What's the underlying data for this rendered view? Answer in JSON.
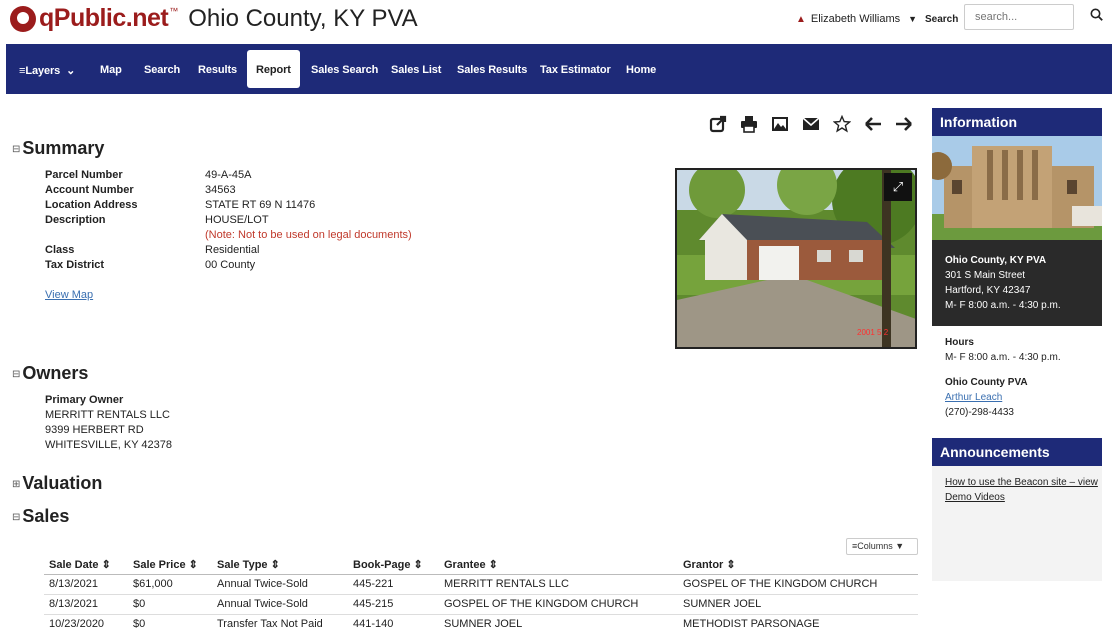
{
  "header": {
    "logo_text": "qPublic.net",
    "logo_tm": "™",
    "county_title": "Ohio County, KY PVA",
    "user_name": "Elizabeth Williams",
    "search_label": "Search",
    "search_placeholder": "search..."
  },
  "nav": {
    "layers": "Layers",
    "map": "Map",
    "search": "Search",
    "results": "Results",
    "report": "Report",
    "sales_search": "Sales Search",
    "sales_list": "Sales List",
    "sales_results": "Sales Results",
    "tax_estimator": "Tax Estimator",
    "home": "Home"
  },
  "summary": {
    "title": "Summary",
    "fields": [
      {
        "label": "Parcel Number",
        "value": "49-A-45A"
      },
      {
        "label": "Account Number",
        "value": "34563"
      },
      {
        "label": "Location Address",
        "value": "STATE RT 69 N 11476"
      },
      {
        "label": "Description",
        "value": "HOUSE/LOT"
      },
      {
        "label": "Class",
        "value": "Residential"
      },
      {
        "label": "Tax District",
        "value": "00 County"
      }
    ],
    "note": "(Note: Not to be used on legal documents)",
    "view_map": "View Map"
  },
  "owners": {
    "title": "Owners",
    "primary_label": "Primary Owner",
    "name": "MERRITT RENTALS LLC",
    "street": "9399 HERBERT RD",
    "city": "WHITESVILLE, KY 42378"
  },
  "valuation": {
    "title": "Valuation"
  },
  "sales": {
    "title": "Sales",
    "columns_btn": "Columns",
    "headers": [
      "Sale Date",
      "Sale Price",
      "Sale Type",
      "Book-Page",
      "Grantee",
      "Grantor"
    ],
    "rows": [
      [
        "8/13/2021",
        "$61,000",
        "Annual Twice-Sold",
        "445-221",
        "MERRITT RENTALS LLC",
        "GOSPEL OF THE KINGDOM CHURCH"
      ],
      [
        "8/13/2021",
        "$0",
        "Annual Twice-Sold",
        "445-215",
        "GOSPEL OF THE KINGDOM CHURCH",
        "SUMNER JOEL"
      ],
      [
        "10/23/2020",
        "$0",
        "Transfer Tax Not Paid",
        "441-140",
        "SUMNER JOEL",
        "METHODIST PARSONAGE"
      ]
    ]
  },
  "photo": {
    "timestamp": "2001 5 2"
  },
  "sidebar": {
    "info_title": "Information",
    "office_name": "Ohio County, KY PVA",
    "office_street": "301 S Main Street",
    "office_city": "Hartford, KY 42347",
    "office_hours_short": "M- F 8:00 a.m. - 4:30 p.m.",
    "hours_label": "Hours",
    "hours_value": "M- F 8:00 a.m. - 4:30 p.m.",
    "pva_label": "Ohio County PVA",
    "pva_name": "Arthur Leach",
    "pva_phone": "(270)-298-4433",
    "announce_title": "Announcements",
    "announce_link": "How to use the Beacon site – view Demo Videos"
  },
  "colors": {
    "brand": "#9b1c1c",
    "nav": "#1e2a78",
    "note": "#c0392b",
    "link": "#3a6fb0"
  }
}
